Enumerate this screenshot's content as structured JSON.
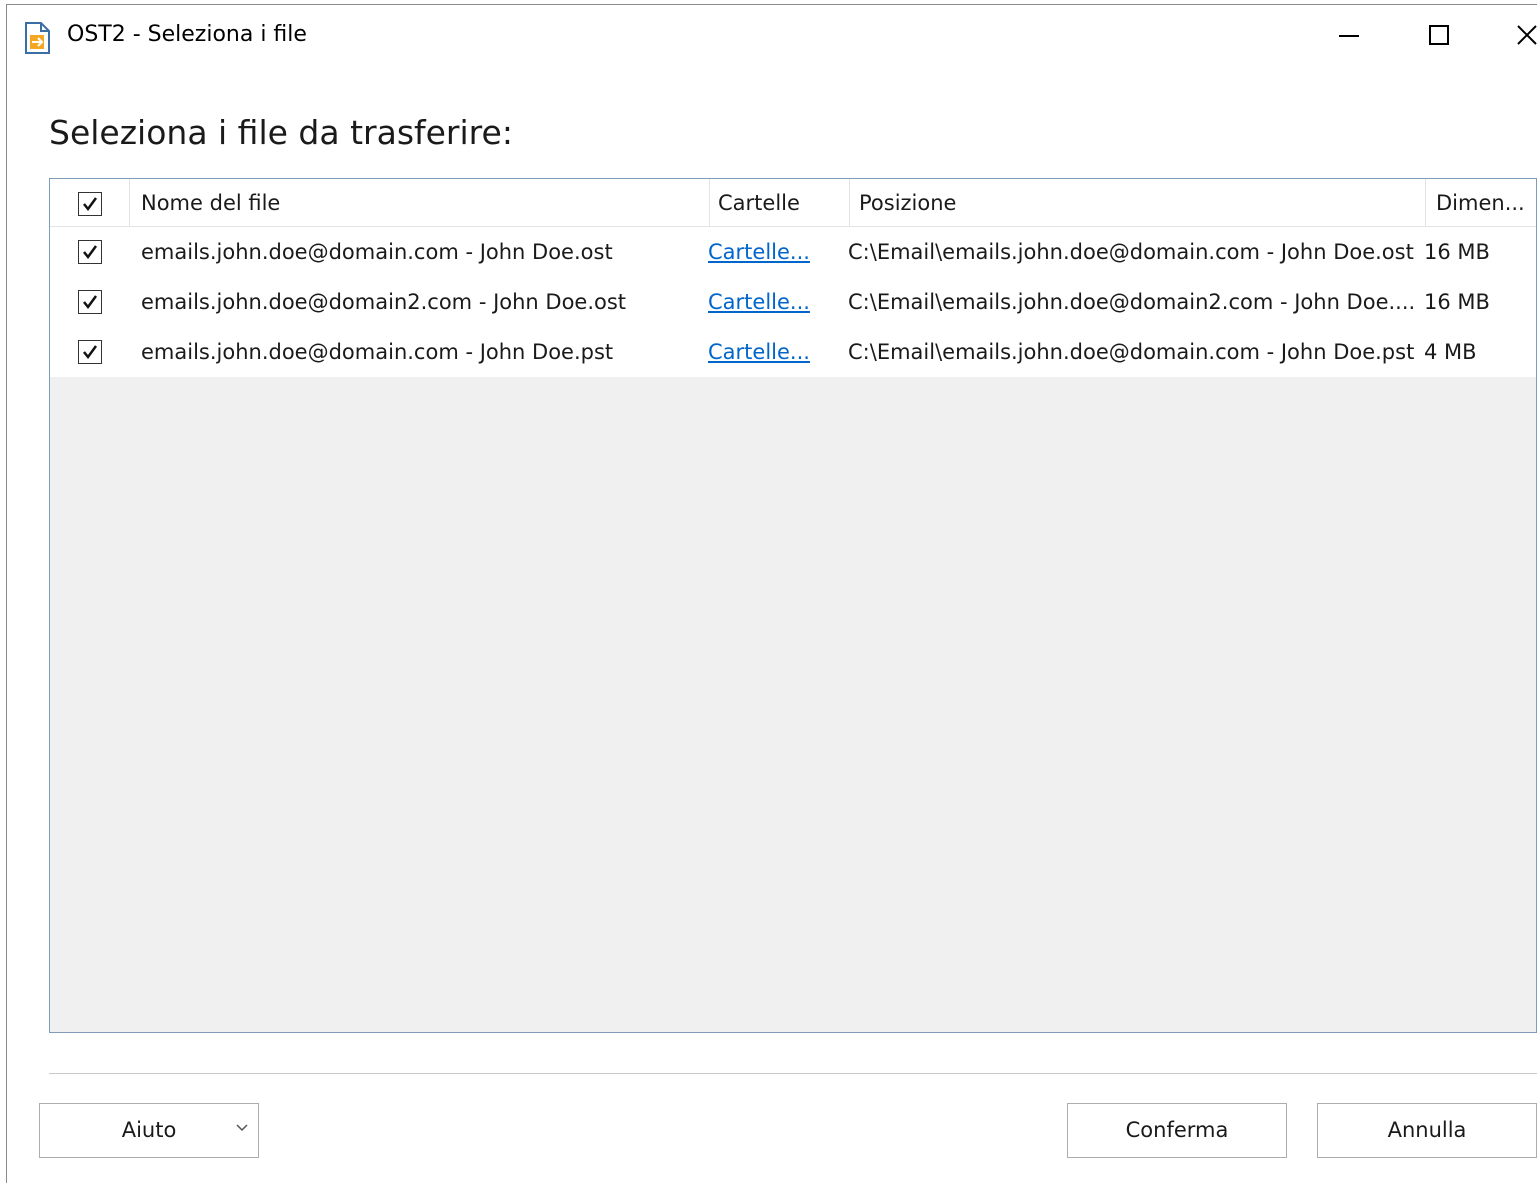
{
  "window": {
    "title": "OST2 - Seleziona i file",
    "icon": "document-arrow-icon"
  },
  "heading": "Seleziona i file da trasferire:",
  "table": {
    "select_all_checked": true,
    "columns": [
      "Nome del file",
      "Cartelle",
      "Posizione",
      "Dimen..."
    ],
    "rows": [
      {
        "checked": true,
        "name": "emails.john.doe@domain.com - John Doe.ost",
        "folders": "Cartelle...",
        "location": "C:\\Email\\emails.john.doe@domain.com - John Doe.ost",
        "size": "16 MB"
      },
      {
        "checked": true,
        "name": "emails.john.doe@domain2.com - John Doe.ost",
        "folders": "Cartelle...",
        "location": "C:\\Email\\emails.john.doe@domain2.com - John Doe....",
        "size": "16 MB"
      },
      {
        "checked": true,
        "name": "emails.john.doe@domain.com - John Doe.pst",
        "folders": "Cartelle...",
        "location": "C:\\Email\\emails.john.doe@domain.com - John Doe.pst",
        "size": "4 MB"
      }
    ]
  },
  "buttons": {
    "help": "Aiuto",
    "confirm": "Conferma",
    "cancel": "Annulla"
  },
  "colors": {
    "link": "#0066cc",
    "list_border": "#7f9db9",
    "list_empty_bg": "#f0f0f0"
  }
}
